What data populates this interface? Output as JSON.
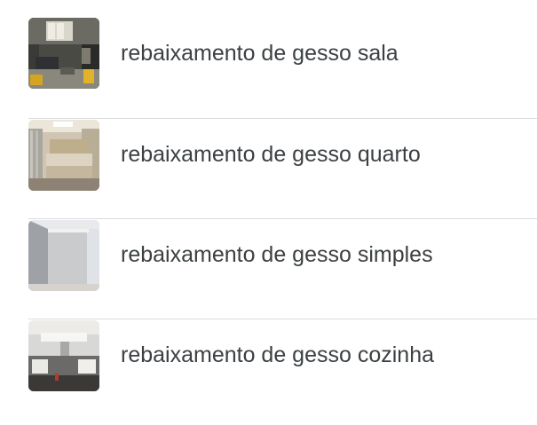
{
  "results": [
    {
      "label": "rebaixamento de gesso sala",
      "thumb_icon": "living-room-thumbnail"
    },
    {
      "label": "rebaixamento de gesso quarto",
      "thumb_icon": "bedroom-thumbnail"
    },
    {
      "label": "rebaixamento de gesso simples",
      "thumb_icon": "plain-wall-thumbnail"
    },
    {
      "label": "rebaixamento de gesso cozinha",
      "thumb_icon": "kitchen-thumbnail"
    }
  ],
  "colors": {
    "text": "#3c4043",
    "divider": "#dadce0"
  }
}
